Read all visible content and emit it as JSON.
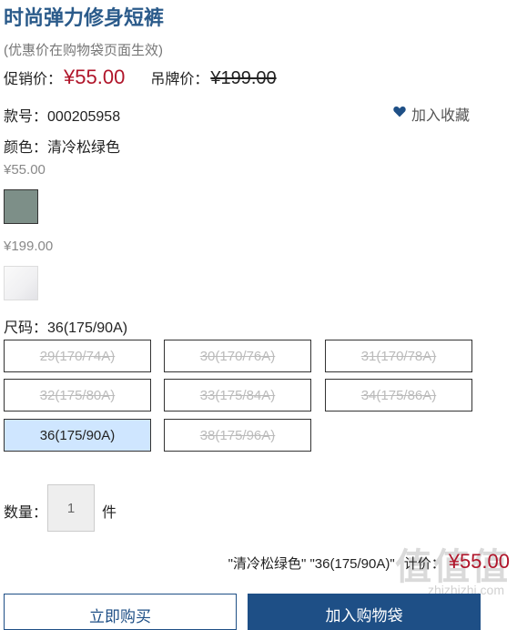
{
  "product": {
    "title": "时尚弹力修身短裤",
    "subtitle": "(优惠价在购物袋页面生效)",
    "sale_label": "促销价：",
    "sale_price": "¥55.00",
    "tag_label": "吊牌价：",
    "tag_price": "¥199.00",
    "sku_label": "款号：",
    "sku": "000205958",
    "favorite_label": "加入收藏",
    "color_label": "颜色：",
    "color_value": "清冷松绿色"
  },
  "swatches": [
    {
      "price": "¥55.00",
      "color": "#7d8f88",
      "selected": true
    },
    {
      "price": "¥199.00",
      "color": "#f0f0f2",
      "selected": false
    }
  ],
  "sizes": {
    "label": "尺码：",
    "selected_value": "36(175/90A)",
    "options": [
      {
        "label": "29(170/74A)",
        "state": "disabled"
      },
      {
        "label": "30(170/76A)",
        "state": "disabled"
      },
      {
        "label": "31(170/78A)",
        "state": "disabled"
      },
      {
        "label": "32(175/80A)",
        "state": "disabled"
      },
      {
        "label": "33(175/84A)",
        "state": "disabled"
      },
      {
        "label": "34(175/86A)",
        "state": "disabled"
      },
      {
        "label": "36(175/90A)",
        "state": "selected"
      },
      {
        "label": "38(175/96A)",
        "state": "disabled"
      }
    ]
  },
  "quantity": {
    "label": "数量：",
    "value": "1",
    "unit": "件"
  },
  "summary": {
    "selection": "\"清冷松绿色\" \"36(175/90A)\"",
    "total_label": "计价：",
    "total": "¥55.00"
  },
  "actions": {
    "buy_now": "立即购买",
    "add_to_cart": "加入购物袋"
  },
  "watermark": {
    "main": "值值值",
    "site": "zhizhizhi.com"
  },
  "colors": {
    "accent": "#1e4f86",
    "price": "#b0152a",
    "selected_size_bg": "#cfe6ff"
  }
}
